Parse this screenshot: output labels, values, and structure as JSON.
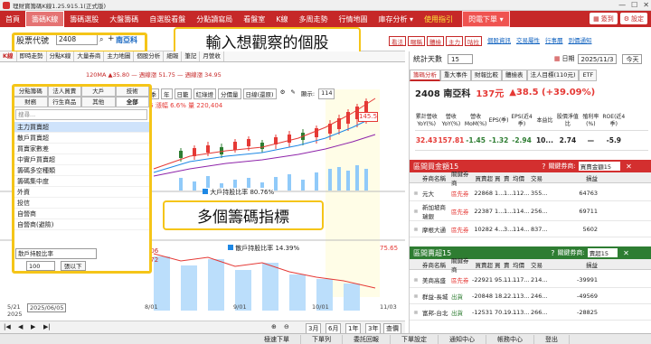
{
  "window": {
    "title": "理財寶籌碼K線1.25.915.1(正式版)"
  },
  "menu": {
    "items": [
      {
        "label": "首頁",
        "active": false
      },
      {
        "label": "籌碼K線",
        "active": true
      },
      {
        "label": "籌碼選股",
        "active": false
      },
      {
        "label": "大盤籌碼",
        "active": false
      },
      {
        "label": "自選股看盤",
        "active": false
      },
      {
        "label": "分點讀寫局",
        "active": false
      },
      {
        "label": "看盤室",
        "active": false
      },
      {
        "label": "K線",
        "active": false
      },
      {
        "label": "多周走勢",
        "active": false
      },
      {
        "label": "行情地圖",
        "active": false
      },
      {
        "label": "庫存分析 ▾",
        "active": false
      }
    ],
    "guide_label": "使用指引",
    "flash_label": "閃電下單 ▾",
    "signin": "簽到",
    "setting": "設定"
  },
  "stock": {
    "field_label": "股票代號",
    "code": "2408",
    "name": "南亞科"
  },
  "callouts": {
    "top": "輸入想觀察的個股",
    "middle": "多個籌碼指標"
  },
  "toolbar": {
    "buttons": [
      "看法",
      "暱稱",
      "體檢",
      "主力",
      "咕拉"
    ],
    "links": [
      "個股資訊",
      "交易屬性",
      "行事曆",
      "到價通知"
    ]
  },
  "subtabs": [
    "K線",
    "即時走勢",
    "分點K線",
    "大量券商",
    "主力地圖",
    "個股分析",
    "細報",
    "筆記",
    "月營收"
  ],
  "chart": {
    "ma_legend": "120MA ▲35.80  — 週線漲 51.75  — 週線漲 34.95",
    "controls": [
      "日",
      "週",
      "月",
      "季",
      "年",
      "日籠",
      "紅綠燈",
      "分價量",
      "日線(還原)"
    ],
    "display_label": "顯示:",
    "display_value": "114",
    "ohlc": "52.5  漲跌 3.25  漲幅 6.6%  量 220,404",
    "price_tag": "145.5",
    "price_scale_right": [
      "145.5",
      "75.65"
    ],
    "panel_major": "大戶持股比率 80.76%",
    "panel_minor": "散戶持股比率 14.39%",
    "big_count": "人數 142,506",
    "small_count": "張數 446,372",
    "dates": [
      "5/21",
      "2025/06/05",
      "8/01",
      "9/01",
      "10/01",
      "11/03"
    ],
    "dates_year": "2025"
  },
  "chip_picker": {
    "tabs": [
      "分點籌碼",
      "法人買賣",
      "大戶",
      "技術",
      "財務",
      "行生商品",
      "其他",
      "全部"
    ],
    "search_placeholder": "搜尋...",
    "items": [
      "主力買賣超",
      "散戶買賣超",
      "買賣家數差",
      "中實戶買賣超",
      "籌碼多空種類",
      "籌碼集中度",
      "外資",
      "投信",
      "自營商",
      "自營商(避險)"
    ],
    "selected_index": 0,
    "bottom_select": "散戶持股比率",
    "count_value": "100",
    "count_label": "張以下"
  },
  "bottomnav": {
    "periods": [
      "3月",
      "6月",
      "1年",
      "3年"
    ],
    "more": "查價"
  },
  "right": {
    "stat_days_label": "統計天數",
    "stat_days_value": "15",
    "date_label": "日期",
    "date_value": "2025/11/3",
    "today_btn": "今天",
    "tabs": [
      "籌碼分析",
      "重大事件",
      "財報比較",
      "體檢表",
      "法人目標(110元)",
      "ETF"
    ],
    "quote": {
      "code_name": "2408 南亞科",
      "price": "137元",
      "change": "▲38.5 (+39.09%)"
    },
    "kpi_headers": [
      "累計營收YoY(%)",
      "營收YoY(%)",
      "營收MoM(%)",
      "EPS(季)",
      "EPS(近4季)",
      "本益比",
      "股價淨值比",
      "殖利率(%)",
      "ROE(近4季)"
    ],
    "kpi_values": [
      "32.43",
      "157.81",
      "-1.45",
      "-1.32",
      "-2.94",
      "10...",
      "2.74",
      "—",
      "-5.9"
    ],
    "buy_panel": {
      "title": "區間買金額15",
      "type_label": "關鍵券商:",
      "type_value": "買賣金額15"
    },
    "sell_panel": {
      "title": "區間賣超15",
      "type_label": "關鍵券商:",
      "type_value": "賣超15"
    },
    "table_headers": [
      "券商名稱",
      "關鍵券商",
      "買賣超",
      "買",
      "賣",
      "均價",
      "交易",
      "損益"
    ],
    "buy_rows": [
      {
        "name": "元大",
        "tag": "區先券",
        "net": "22868",
        "b": "1...",
        "s": "1...",
        "avg": "112...",
        "trade": "355...",
        "pnl": "64763"
      },
      {
        "name": "新加坡商瑞銀",
        "tag": "區先券",
        "net": "22387",
        "b": "1...",
        "s": "1...",
        "avg": "114...",
        "trade": "256...",
        "pnl": "69711"
      },
      {
        "name": "摩根大通",
        "tag": "區先券",
        "net": "10282",
        "b": "4...",
        "s": "3...",
        "avg": "114...",
        "trade": "837...",
        "pnl": "5602"
      }
    ],
    "sell_rows": [
      {
        "name": "美商高盛",
        "tag": "區先券",
        "net": "-22921",
        "b": "95...",
        "s": "11...",
        "avg": "117...",
        "trade": "214...",
        "pnl": "-39991"
      },
      {
        "name": "群益-長城",
        "tag": "出貨",
        "net": "-20848",
        "b": "18...",
        "s": "22...",
        "avg": "113...",
        "trade": "246...",
        "pnl": "-49569"
      },
      {
        "name": "富邦-台北",
        "tag": "出貨",
        "net": "-12531",
        "b": "70...",
        "s": "19...",
        "avg": "113...",
        "trade": "266...",
        "pnl": "-28825"
      }
    ]
  },
  "status": [
    "極速下單",
    "下單列",
    "委託回報",
    "下單設定",
    "通知中心",
    "帳務中心",
    "登出"
  ],
  "colors": {
    "brand_red": "#c62828",
    "up": "#e53935",
    "down": "#2e7d32",
    "highlight": "#f5c518"
  }
}
